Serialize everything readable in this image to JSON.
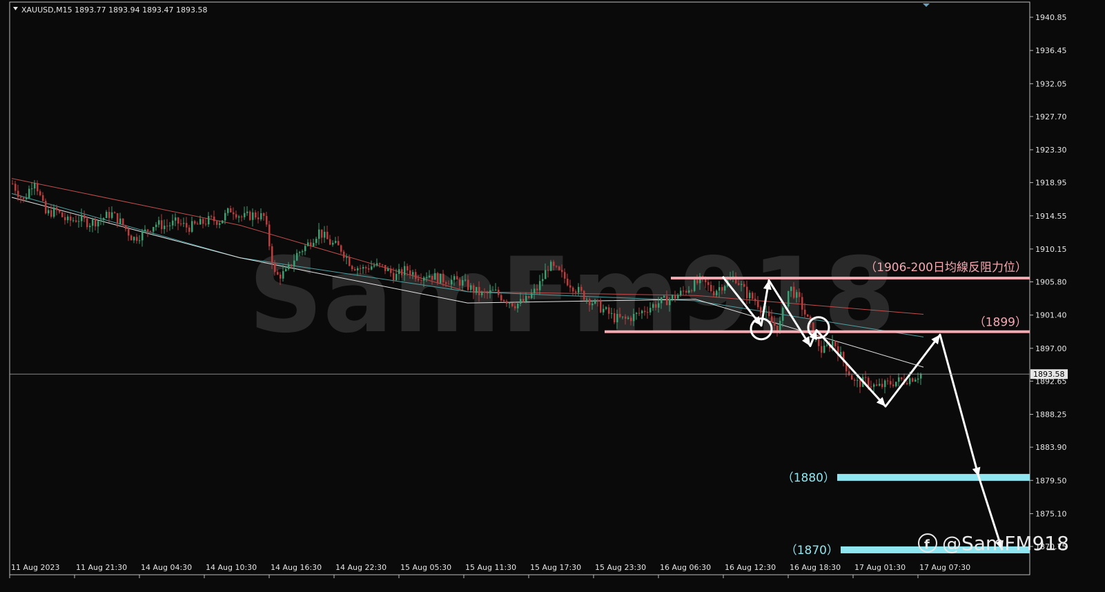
{
  "header": {
    "symbol_line": "XAUUSD,M15  1893.77 1893.94 1893.47 1893.58"
  },
  "watermark": "SamFm918",
  "brand_label": "@SamFM918",
  "colors": {
    "background": "#0a0a0a",
    "frame": "#bfbfbf",
    "candle_up": "#33a374",
    "candle_down": "#c23a3a",
    "ma_white": "#e6e6e6",
    "ma_teal": "#4fa3a5",
    "ma_red": "#c24d4d",
    "pink_line": "#f7a8b0",
    "cyan_bar": "#8fe6f0",
    "arrow": "#ffffff"
  },
  "chart_data": {
    "type": "line",
    "symbol": "XAUUSD",
    "timeframe": "M15",
    "ohlc_current": {
      "open": 1893.77,
      "high": 1893.94,
      "low": 1893.47,
      "close": 1893.58
    },
    "y_axis_ticks": [
      "1940.85",
      "1936.45",
      "1932.05",
      "1927.70",
      "1923.30",
      "1918.95",
      "1914.55",
      "1910.15",
      "1905.80",
      "1901.40",
      "1897.00",
      "1892.65",
      "1888.25",
      "1883.90",
      "1879.50",
      "1875.10",
      "1870.75"
    ],
    "ylim": [
      1869.5,
      1942.0
    ],
    "x_axis_ticks": [
      "11 Aug 2023",
      "11 Aug 21:30",
      "14 Aug 04:30",
      "14 Aug 10:30",
      "14 Aug 16:30",
      "14 Aug 22:30",
      "15 Aug 05:30",
      "15 Aug 11:30",
      "15 Aug 17:30",
      "15 Aug 23:30",
      "16 Aug 06:30",
      "16 Aug 12:30",
      "16 Aug 18:30",
      "17 Aug 01:30",
      "17 Aug 07:30"
    ],
    "current_price": "1893.58",
    "close_path": [
      1918.8,
      1916.5,
      1919.5,
      1914.8,
      1915.2,
      1913.8,
      1914.2,
      1913.6,
      1914.0,
      1914.9,
      1913.5,
      1911.5,
      1912.3,
      1913.5,
      1913.2,
      1913.7,
      1913.0,
      1913.4,
      1914.0,
      1913.9,
      1915.5,
      1914.3,
      1914.7,
      1914.4,
      1906.5,
      1907.0,
      1909.5,
      1910.8,
      1912.5,
      1911.0,
      1910.2,
      1908.0,
      1907.5,
      1908.0,
      1907.6,
      1906.5,
      1907.5,
      1906.6,
      1906.8,
      1906.2,
      1906.0,
      1905.8,
      1904.8,
      1904.0,
      1904.5,
      1903.5,
      1902.8,
      1903.4,
      1905.0,
      1908.0,
      1906.9,
      1905.5,
      1904.2,
      1903.1,
      1902.1,
      1901.0,
      1900.8,
      1901.4,
      1902.3,
      1903.0,
      1903.5,
      1904.2,
      1905.2,
      1906.0,
      1904.5,
      1905.5,
      1906.5,
      1904.3,
      1903.2,
      1901.0,
      1899.5,
      1905.2,
      1903.0,
      1899.5,
      1896.5,
      1898.0,
      1895.0,
      1892.3,
      1892.6,
      1891.8,
      1892.3,
      1892.7,
      1893.0,
      1893.58
    ],
    "ma_slow_anchor": [
      1919.5,
      1913.3,
      1904.5,
      1904.0,
      1901.5
    ],
    "ma_mid_anchor": [
      1917.5,
      1909.0,
      1904.5,
      1903.3,
      1898.5
    ],
    "ma_fast_anchor": [
      1917.0,
      1909.0,
      1903.0,
      1903.5,
      1894.5
    ],
    "annotations": {
      "resistance_label": "（1906-200日均線反阻力位）",
      "resistance_level": 1906.3,
      "mid_label": "（1899）",
      "mid_level": 1899.2,
      "support_1_label": "（1880）",
      "support_1_level": 1879.9,
      "support_2_label": "（1870）",
      "support_2_level": 1870.3,
      "projected_path_prices": [
        1906.5,
        1900.0,
        1906.0,
        1897.3,
        1899.4,
        1889.3,
        1898.8,
        1880.0,
        1870.3
      ]
    }
  }
}
